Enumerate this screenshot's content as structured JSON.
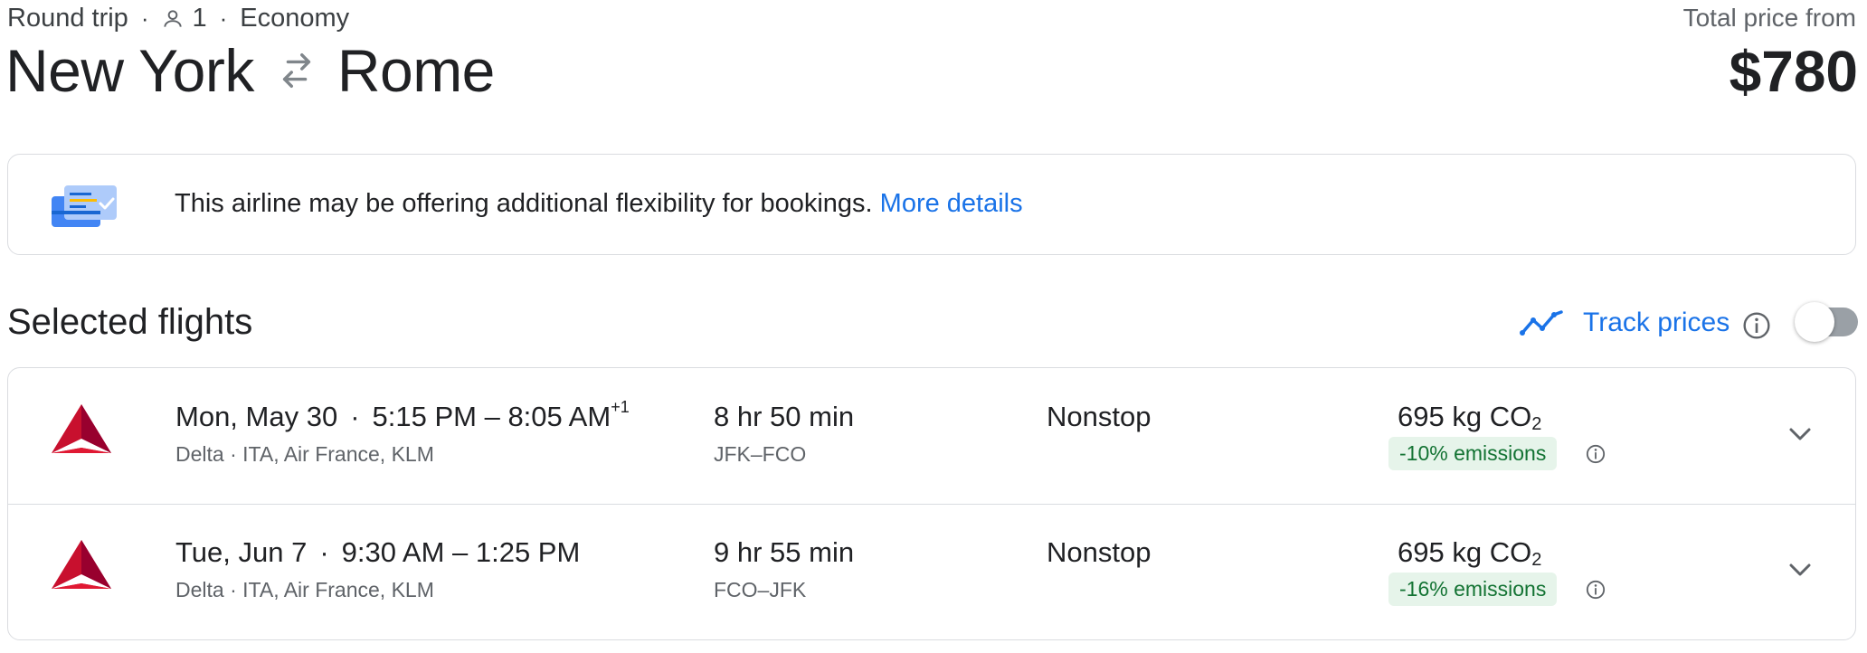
{
  "header": {
    "trip_type": "Round trip",
    "dot": "·",
    "passengers": "1",
    "cabin": "Economy",
    "origin": "New York",
    "destination": "Rome",
    "price_label": "Total price from",
    "price": "$780"
  },
  "banner": {
    "text": "This airline may be offering additional flexibility for bookings.",
    "link": "More details"
  },
  "selected": {
    "title": "Selected flights",
    "track_label": "Track prices",
    "track_enabled": false
  },
  "flights": [
    {
      "date": "Mon, May 30",
      "sep": "·",
      "times": "5:15 PM – 8:05 AM",
      "day_offset": "+1",
      "airline": "Delta · ITA, Air France, KLM",
      "duration": "8 hr 50 min",
      "airports": "JFK–FCO",
      "stops": "Nonstop",
      "co2_value": "695 kg CO",
      "co2_sub": "2",
      "emissions": "-10% emissions"
    },
    {
      "date": "Tue, Jun 7",
      "sep": "·",
      "times": "9:30 AM – 1:25 PM",
      "day_offset": "",
      "airline": "Delta · ITA, Air France, KLM",
      "duration": "9 hr 55 min",
      "airports": "FCO–JFK",
      "stops": "Nonstop",
      "co2_value": "695 kg CO",
      "co2_sub": "2",
      "emissions": "-16% emissions"
    }
  ],
  "colors": {
    "link_blue": "#1a73e8",
    "emissions_green": "#137333",
    "emissions_bg": "#e6f4ea",
    "delta_red": "#c8102e",
    "border": "#dadce0"
  },
  "icons": {
    "passenger": "person-icon",
    "swap": "swap-arrows-icon",
    "banner": "flexible-booking-icon",
    "track": "trend-line-icon",
    "info": "info-icon",
    "expand": "chevron-down-icon",
    "airline": "delta-logo"
  }
}
